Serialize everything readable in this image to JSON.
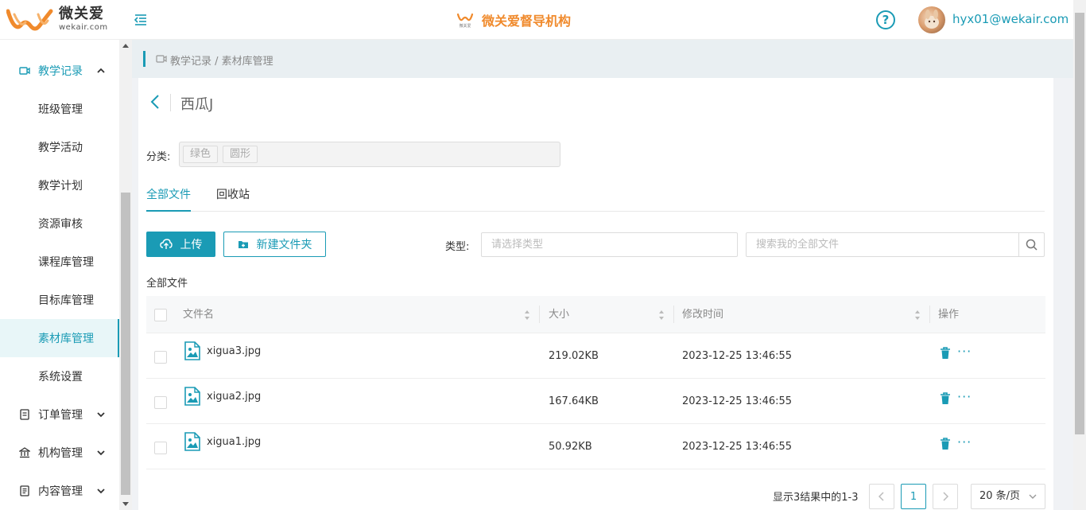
{
  "brand": {
    "name": "微关爱",
    "domain": "wekair.com",
    "center_title": "微关爱督导机构",
    "center_logo_text": "微关爱",
    "accent_color": "#1a9bb5",
    "brand_color": "#f08a2c"
  },
  "header": {
    "help_glyph": "?",
    "user_email": "hyx01@wekair.com"
  },
  "sidebar": {
    "groups": [
      {
        "label": "教学记录",
        "icon": "video-camera-icon",
        "expanded": true,
        "items": [
          {
            "label": "班级管理"
          },
          {
            "label": "教学活动"
          },
          {
            "label": "教学计划"
          },
          {
            "label": "资源审核"
          },
          {
            "label": "课程库管理"
          },
          {
            "label": "目标库管理"
          },
          {
            "label": "素材库管理",
            "active": true
          },
          {
            "label": "系统设置"
          }
        ]
      },
      {
        "label": "订单管理",
        "icon": "order-icon",
        "expanded": false
      },
      {
        "label": "机构管理",
        "icon": "institution-icon",
        "expanded": false
      },
      {
        "label": "内容管理",
        "icon": "content-icon",
        "expanded": false
      }
    ]
  },
  "breadcrumb": {
    "text": "教学记录 / 素材库管理"
  },
  "main": {
    "title": "西瓜J",
    "category_label": "分类:",
    "tags": [
      "绿色",
      "圆形"
    ],
    "tabs": [
      {
        "label": "全部文件",
        "active": true
      },
      {
        "label": "回收站",
        "active": false
      }
    ],
    "upload_label": "上传",
    "new_folder_label": "新建文件夹",
    "type_label": "类型:",
    "type_placeholder": "请选择类型",
    "search_placeholder": "搜索我的全部文件",
    "path_label": "全部文件"
  },
  "table": {
    "columns": {
      "name": "文件名",
      "size": "大小",
      "modified": "修改时间",
      "actions": "操作"
    },
    "rows": [
      {
        "name": "xigua3.jpg",
        "size": "219.02KB",
        "modified": "2023-12-25 13:46:55"
      },
      {
        "name": "xigua2.jpg",
        "size": "167.64KB",
        "modified": "2023-12-25 13:46:55"
      },
      {
        "name": "xigua1.jpg",
        "size": "50.92KB",
        "modified": "2023-12-25 13:46:55"
      }
    ],
    "more_glyph": "···"
  },
  "pagination": {
    "info": "显示3结果中的1-3",
    "current_page": "1",
    "page_size": "20 条/页"
  }
}
